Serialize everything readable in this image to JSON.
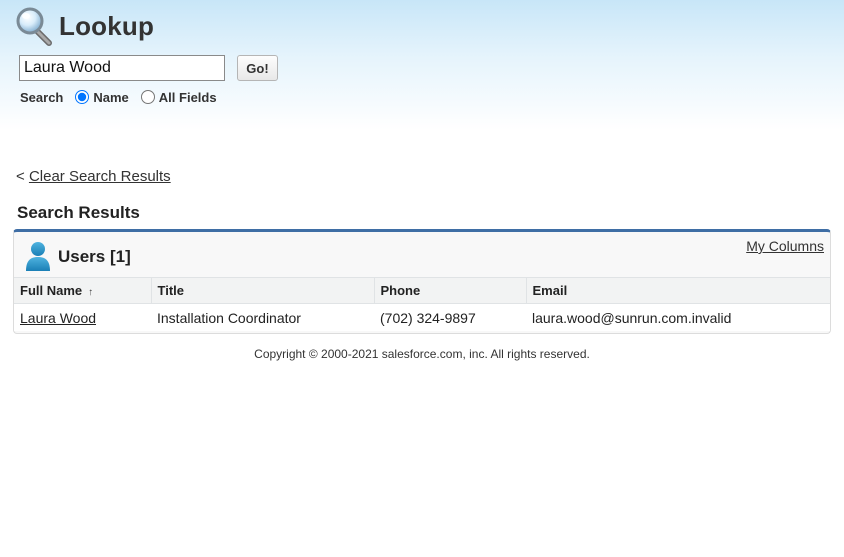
{
  "header": {
    "title": "Lookup",
    "icon": "magnifier-icon"
  },
  "search": {
    "value": "Laura Wood",
    "go_label": "Go!",
    "search_label": "Search",
    "option_name": "Name",
    "option_all_fields": "All Fields",
    "selected_option": "Name"
  },
  "results": {
    "clear_prefix": "<",
    "clear_link": "Clear Search Results",
    "heading": "Search Results",
    "panel_title": "Users [1]",
    "my_columns": "My Columns",
    "accent_color": "#3f6ea5",
    "columns": [
      "Full Name",
      "Title",
      "Phone",
      "Email"
    ],
    "sort_indicator": "↑",
    "rows": [
      {
        "full_name": "Laura Wood",
        "title": "Installation Coordinator",
        "phone": "(702) 324-9897",
        "email": "laura.wood@sunrun.com.invalid"
      }
    ]
  },
  "footer": {
    "copyright": "Copyright © 2000-2021 salesforce.com, inc. All rights reserved."
  }
}
